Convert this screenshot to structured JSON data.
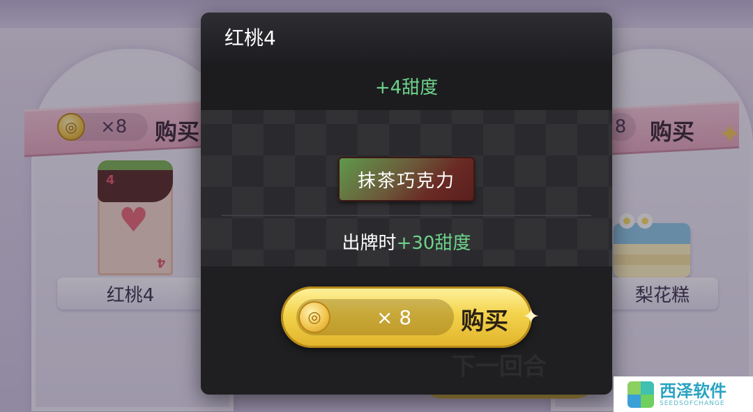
{
  "background": {
    "left_item": {
      "price": "×8",
      "buy_label": "购买",
      "name": "红桃4",
      "card_rank": "4"
    },
    "right_item": {
      "price": "8",
      "buy_label": "购买",
      "name": "梨花糕"
    },
    "next_round_label": "下一回合"
  },
  "modal": {
    "title": "红桃4",
    "base_effect": "+4甜度",
    "tag_name": "抹茶巧克力",
    "tag_effect_prefix": "出牌时",
    "tag_effect_value": "+30甜度",
    "buy_button": {
      "qty": "× 8",
      "label": "购买"
    }
  },
  "watermark": {
    "title": "西泽软件",
    "subtitle": "SEEDSOFCHANGE"
  },
  "colors": {
    "sweetness_green": "#6ed38a",
    "gold": "#f3d34c",
    "modal_bg": "#26262a"
  },
  "icons": {
    "currency": "coin-icon"
  }
}
